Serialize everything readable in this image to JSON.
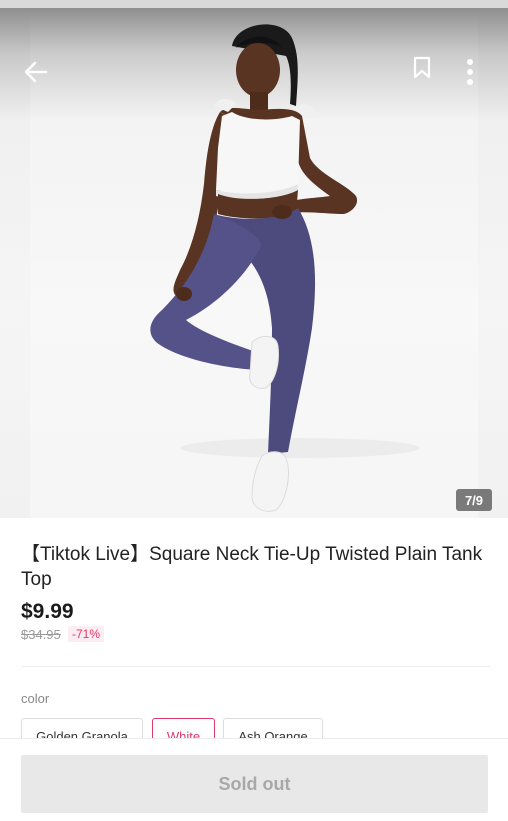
{
  "header": {
    "back_icon": "arrow-left-icon",
    "bookmark_icon": "bookmark-icon",
    "more_icon": "more-vertical-icon"
  },
  "gallery": {
    "counter": "7/9"
  },
  "product": {
    "title": "【Tiktok Live】Square Neck Tie-Up Twisted Plain Tank Top",
    "price": "$9.99",
    "original_price": "$34.95",
    "discount": "-71%"
  },
  "options": {
    "color_label": "color",
    "swatches": [
      {
        "label": "Golden Granola",
        "selected": false
      },
      {
        "label": "White",
        "selected": true
      },
      {
        "label": "Ash Orange",
        "selected": false
      }
    ]
  },
  "footer": {
    "button_label": "Sold out"
  },
  "colors": {
    "accent": "#e03a6a",
    "button_bg": "#e8e8e8",
    "button_text": "#a8a8a8"
  }
}
